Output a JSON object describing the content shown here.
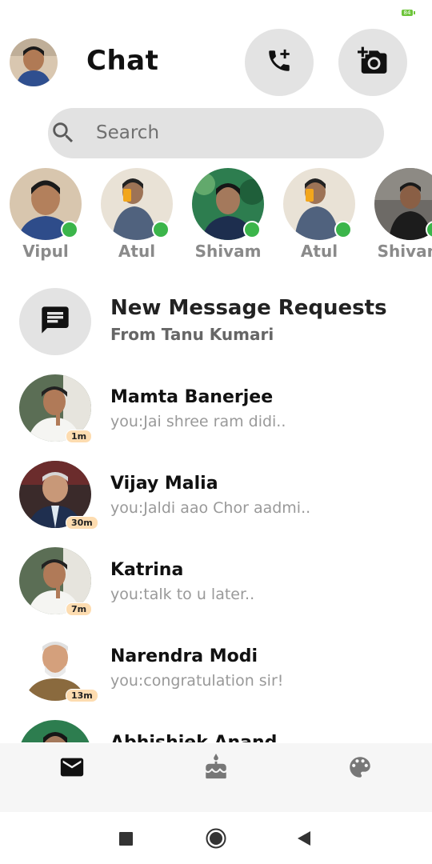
{
  "status": {
    "battery": "84"
  },
  "header": {
    "title": "Chat"
  },
  "search": {
    "placeholder": "Search"
  },
  "stories": [
    {
      "name": "Vipul",
      "online": true
    },
    {
      "name": "Atul",
      "online": true
    },
    {
      "name": "Shivam",
      "online": true
    },
    {
      "name": "Atul",
      "online": true
    },
    {
      "name": "Shivam",
      "online": true
    }
  ],
  "requests": {
    "title": "New Message Requests",
    "subtitle": "From Tanu Kumari"
  },
  "chats": [
    {
      "name": "Mamta Banerjee",
      "message": "you:Jai shree ram didi..",
      "time": "1m"
    },
    {
      "name": "Vijay Malia",
      "message": "you:Jaldi aao Chor aadmi..",
      "time": "30m"
    },
    {
      "name": "Katrina",
      "message": "you:talk to u later..",
      "time": "7m"
    },
    {
      "name": "Narendra Modi",
      "message": "you:congratulation sir!",
      "time": "13m"
    },
    {
      "name": "Abhishiek Anand",
      "message": "",
      "time": ""
    }
  ],
  "bottom_nav": [
    {
      "icon": "mail-icon",
      "active": true
    },
    {
      "icon": "cake-icon",
      "active": false
    },
    {
      "icon": "palette-icon",
      "active": false
    }
  ],
  "colors": {
    "online": "#3bb54a",
    "button_bg": "#e3e3e3",
    "time_badge": "#fddcb0"
  }
}
